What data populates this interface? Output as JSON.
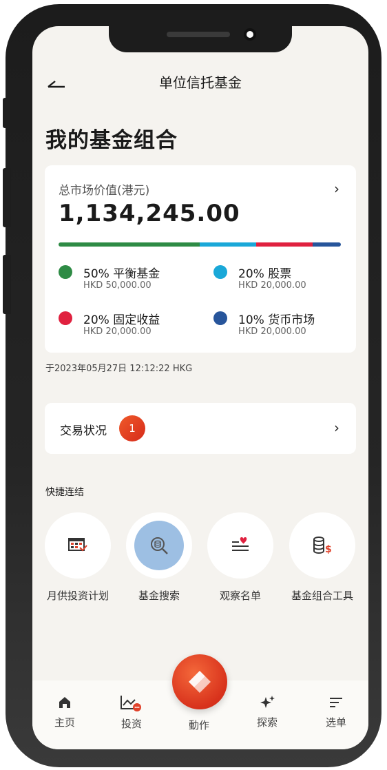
{
  "header": {
    "title": "单位信托基金"
  },
  "page_title": "我的基金组合",
  "portfolio": {
    "market_value_label": "总市场价值(港元)",
    "market_value": "1,134,245.00",
    "allocation": [
      {
        "name": "50% 平衡基金",
        "amount": "HKD 50,000.00",
        "percent": 50,
        "color": "#2e8b45"
      },
      {
        "name": "20% 股票",
        "amount": "HKD 20,000.00",
        "percent": 20,
        "color": "#1aa8d8"
      },
      {
        "name": "20% 固定收益",
        "amount": "HKD 20,000.00",
        "percent": 20,
        "color": "#e0213f"
      },
      {
        "name": "10% 货币市场",
        "amount": "HKD 20,000.00",
        "percent": 10,
        "color": "#27559b"
      }
    ]
  },
  "timestamp": "于2023年05月27日 12:12:22 HKG",
  "transaction": {
    "label": "交易状况",
    "badge": "1"
  },
  "quick_links": {
    "title": "快捷连结",
    "items": [
      {
        "label": "月供投资计划",
        "icon": "calendar-plan-icon"
      },
      {
        "label": "基金搜索",
        "icon": "fund-search-icon"
      },
      {
        "label": "观察名单",
        "icon": "watchlist-heart-icon"
      },
      {
        "label": "基金组合工具",
        "icon": "coins-dollar-icon"
      }
    ]
  },
  "bottom_nav": {
    "items": [
      {
        "label": "主页",
        "icon": "home-icon"
      },
      {
        "label": "投资",
        "icon": "invest-chart-icon"
      },
      {
        "label": "動作",
        "icon": "action-icon"
      },
      {
        "label": "探索",
        "icon": "sparkle-icon"
      },
      {
        "label": "选单",
        "icon": "menu-icon"
      }
    ]
  },
  "colors": {
    "accent": "#e0412a",
    "background": "#f5f3ef"
  }
}
